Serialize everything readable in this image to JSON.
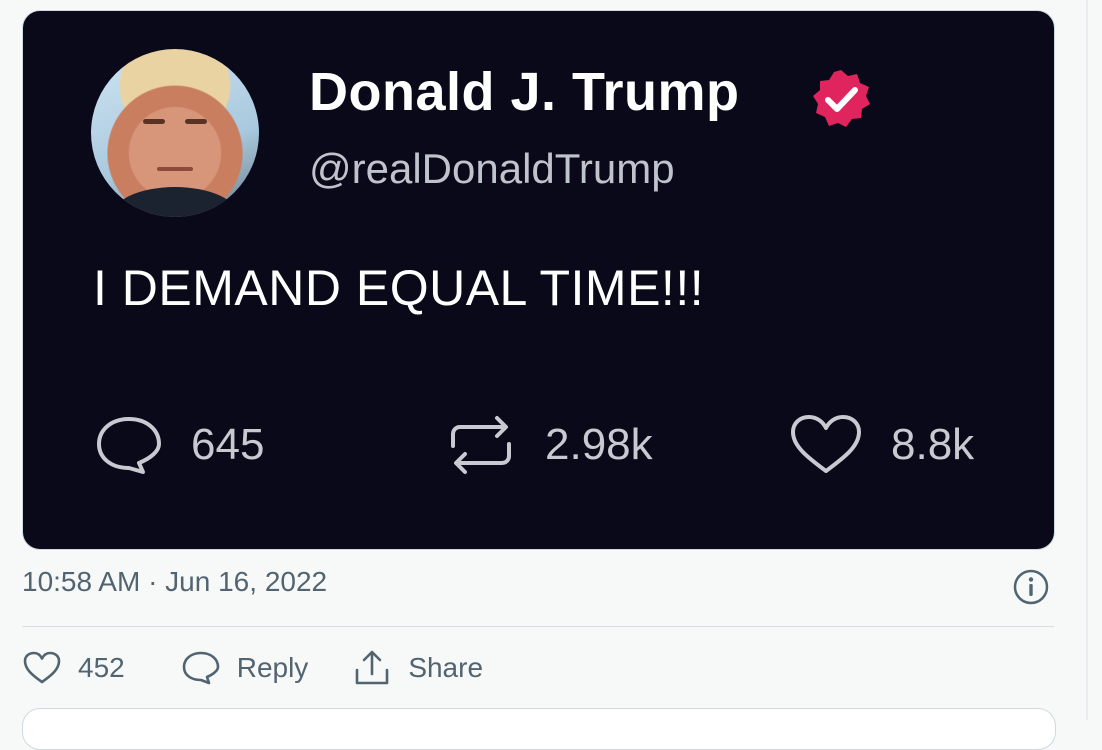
{
  "embedded_tweet": {
    "name": "Donald J. Trump",
    "handle": "@realDonaldTrump",
    "text": "I DEMAND EQUAL TIME!!!",
    "stats": {
      "replies": "645",
      "retweets": "2.98k",
      "likes": "8.8k"
    },
    "verified_badge_color": "#e0245e"
  },
  "tweet_meta": {
    "timestamp": "10:58 AM · Jun 16, 2022"
  },
  "actions": {
    "like_count": "452",
    "reply_label": "Reply",
    "share_label": "Share"
  },
  "icons": [
    "avatar",
    "verified-badge-icon",
    "comment-icon",
    "retweet-icon",
    "heart-icon",
    "info-icon",
    "share-icon"
  ],
  "colors": {
    "card_bg": "#0a0919",
    "muted_text": "#536471",
    "page_bg": "#f7f9f9"
  }
}
